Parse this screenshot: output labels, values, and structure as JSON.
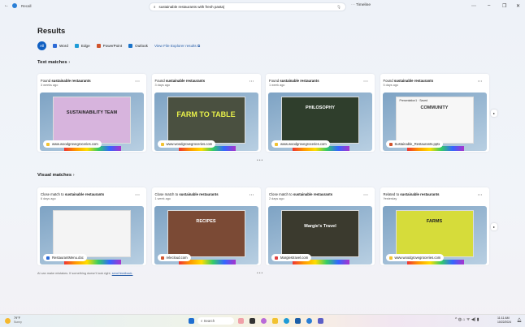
{
  "app": {
    "title": "Recall"
  },
  "search": {
    "value": "sustainable restaurants with fresh pasta|"
  },
  "timeline_label": "Timeline",
  "results_title": "Results",
  "filters": [
    {
      "label": "All",
      "color": "#0f5fc2"
    },
    {
      "label": "Word",
      "color": "#2b6ad6"
    },
    {
      "label": "Edge",
      "color": "#1e9bd7"
    },
    {
      "label": "PowerPoint",
      "color": "#d0532c"
    },
    {
      "label": "Outlook",
      "color": "#1a73c9"
    }
  ],
  "file_explorer_link": "View File Explorer results",
  "text_matches": {
    "title": "Text matches",
    "cards": [
      {
        "prefix": "Found ",
        "term": "sustainable restaurants",
        "time": "3 weeks ago",
        "source": "www.woodgrovegroceries.com",
        "source_color": "#f2c230",
        "slide": "SUSTAINABILITY TEAM",
        "slide_bg": "#d7b4dd",
        "slide_fg": "#222"
      },
      {
        "prefix": "Found ",
        "term": "sustainable restaurants",
        "time": "3 days ago",
        "source": "www.woodgrovegroceries.com",
        "source_color": "#f2c230",
        "slide": "FARM TO TABLE",
        "slide_bg": "#4a5040",
        "slide_fg": "#e8f04a"
      },
      {
        "prefix": "Found ",
        "term": "sustainable restaurants",
        "time": "1 week ago",
        "source": "www.woodgrovegroceries.com",
        "source_color": "#f2c230",
        "slide": "PHILOSOPHY",
        "slide_bg": "#2f3e2c",
        "slide_fg": "#fff"
      },
      {
        "prefix": "Found ",
        "term": "sustainable restaurants",
        "time": "5 days ago",
        "source": "Sustainable_Restaurants.pptx",
        "source_color": "#d0532c",
        "slide": "COMMUNITY",
        "slide_bg": "#f7f7f7",
        "slide_fg": "#333",
        "doc_title": "Presentation1 · Saved"
      }
    ]
  },
  "visual_matches": {
    "title": "Visual matches",
    "cards": [
      {
        "prefix": "Close match to ",
        "term": "sustainable restaurants",
        "time": "6 days ago",
        "source": "RestaurantMenu.doc",
        "source_color": "#2b6ad6",
        "slide": "",
        "slide_bg": "#f4f4f4",
        "slide_fg": "#333"
      },
      {
        "prefix": "Close match to ",
        "term": "sustainable restaurants",
        "time": "1 week ago",
        "source": "relecloud.com",
        "source_color": "#d0532c",
        "slide": "RECIPES",
        "slide_bg": "#7b4a35",
        "slide_fg": "#fff"
      },
      {
        "prefix": "Close match to ",
        "term": "sustainable restaurants",
        "time": "2 days ago",
        "source": "Margiestravel.com",
        "source_color": "#e04040",
        "slide": "Margie's Travel",
        "slide_bg": "#3b3a2e",
        "slide_fg": "#fff"
      },
      {
        "prefix": "Related to ",
        "term": "sustainable restaurants",
        "time": "Yesterday",
        "source": "www.woodgrovegroceries.com",
        "source_color": "#f2c230",
        "slide": "FARMS",
        "slide_bg": "#d6dc3a",
        "slide_fg": "#222"
      }
    ]
  },
  "disclaimer": {
    "text": "AI can make mistakes. If something doesn't look right, ",
    "link": "send feedback."
  },
  "taskbar": {
    "weather_temp": "79°F",
    "weather_desc": "Sunny",
    "search_label": "Search",
    "time": "11:11 AM",
    "date": "10/22/2024"
  }
}
